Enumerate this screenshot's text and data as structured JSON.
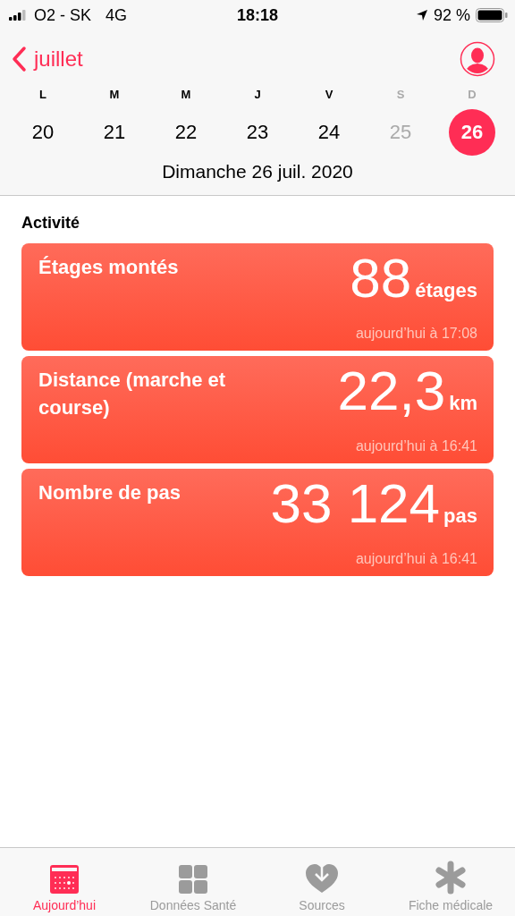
{
  "status_bar": {
    "carrier": "O2 - SK",
    "network": "4G",
    "time": "18:18",
    "battery": "92 %"
  },
  "nav": {
    "back": "juillet"
  },
  "week": [
    {
      "letter": "L",
      "day": "20",
      "weekend": false,
      "selected": false
    },
    {
      "letter": "M",
      "day": "21",
      "weekend": false,
      "selected": false
    },
    {
      "letter": "M",
      "day": "22",
      "weekend": false,
      "selected": false
    },
    {
      "letter": "J",
      "day": "23",
      "weekend": false,
      "selected": false
    },
    {
      "letter": "V",
      "day": "24",
      "weekend": false,
      "selected": false
    },
    {
      "letter": "S",
      "day": "25",
      "weekend": true,
      "selected": false
    },
    {
      "letter": "D",
      "day": "26",
      "weekend": true,
      "selected": true
    }
  ],
  "date": "Dimanche 26 juil. 2020",
  "section": "Activité",
  "cards": [
    {
      "title": "Étages montés",
      "value": "88",
      "unit": "étages",
      "time": "aujourd’hui à 17:08"
    },
    {
      "title": "Distance (marche et course)",
      "value": "22,3",
      "unit": "km",
      "time": "aujourd’hui à 16:41"
    },
    {
      "title": "Nombre de pas",
      "value": "33 124",
      "unit": "pas",
      "time": "aujourd’hui à 16:41"
    }
  ],
  "tabs": [
    {
      "kind": "today",
      "label": "Aujourd’hui",
      "selected": true
    },
    {
      "kind": "data",
      "label": "Données Santé",
      "selected": false
    },
    {
      "kind": "sources",
      "label": "Sources",
      "selected": false
    },
    {
      "kind": "medical",
      "label": "Fiche médicale",
      "selected": false
    }
  ]
}
